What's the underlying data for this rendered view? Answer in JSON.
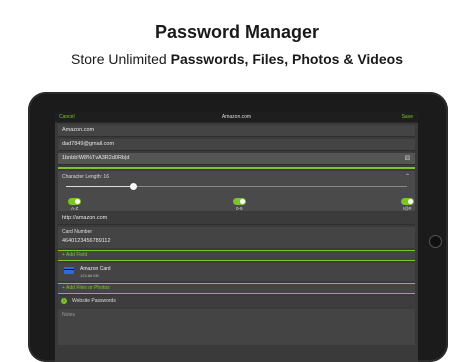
{
  "header": {
    "title": "Password Manager",
    "subtitle_prefix": "Store Unlimited ",
    "subtitle_bold": "Passwords, Files, Photos & Videos"
  },
  "nav": {
    "cancel": "Cancel",
    "title": "Amazon.com",
    "save": "Save"
  },
  "fields": {
    "name": "Amazon.com",
    "username": "dad7849@gmail.com",
    "password": "1bnbb!W8%TvA3R2d0Rb|d",
    "char_length_label": "Character Length: 16",
    "toggles": [
      "A-Z",
      "0-9",
      "!@#"
    ],
    "website": "http://amazon.com",
    "card_label": "Card Number",
    "card_number": "4640123456789112",
    "add_field": "+  Add Field",
    "attachment_name": "Amazon Card",
    "attachment_size": "124.66 KB",
    "add_files": "+  Add Files or Photos",
    "folder": "Website Passwords",
    "notes_placeholder": "Notes"
  },
  "colors": {
    "accent": "#7cc42b",
    "screen_bg": "#3a3a3a"
  },
  "icons": {
    "password_icon": "dice-icon",
    "chevron": "chevron-up-icon"
  }
}
